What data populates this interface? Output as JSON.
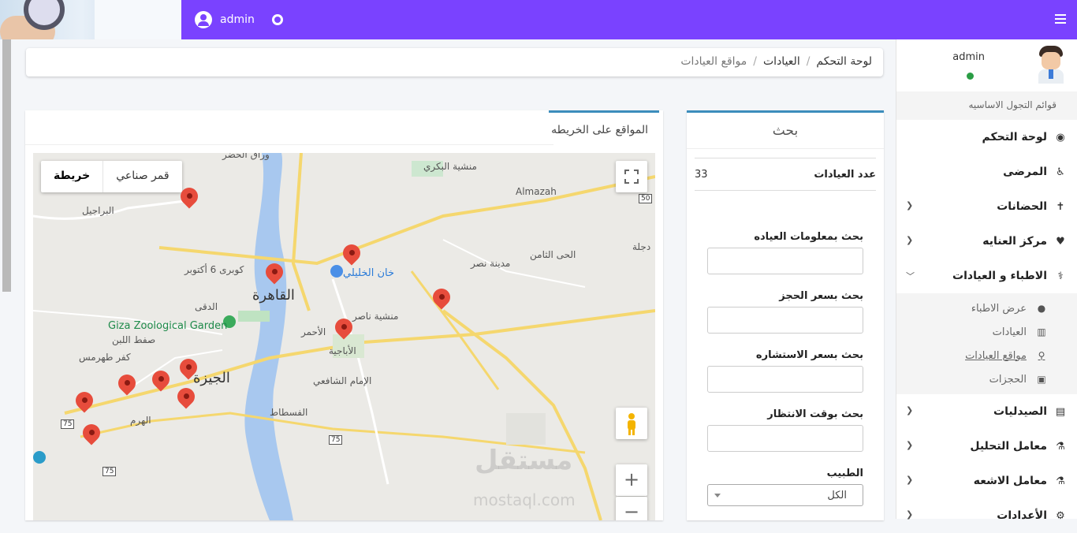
{
  "topbar": {
    "user": "admin"
  },
  "breadcrumb": {
    "items": [
      "لوحة التحكم",
      "العيادات"
    ],
    "current": "مواقع العيادات"
  },
  "search_card": {
    "title": "بحث",
    "count_label": "عدد العيادات",
    "count_value": "33",
    "fields": [
      {
        "label": "بحث بمعلومات العياده"
      },
      {
        "label": "بحث بسعر الحجز"
      },
      {
        "label": "بحث بسعر الاستشاره"
      },
      {
        "label": "بحث بوقت الانتظار"
      }
    ],
    "doctor_label": "الطبيب",
    "doctor_value": "الكل"
  },
  "map_card": {
    "tab": "المواقع على الخريطه",
    "maptype": {
      "map": "خريطة",
      "satellite": "قمر صناعي"
    },
    "labels": {
      "cairo": "القاهرة",
      "giza": "الجيزة",
      "zoo": "Giza Zoological Garden",
      "almazah": "Almazah",
      "khan": "خان الخليلي",
      "warraq": "وراق الحضر",
      "bakry": "منشية البكري",
      "barajil": "البراجيل",
      "tamen": "الحى الثامن",
      "nasr": "مدينة نصر",
      "fustat": "الفسطاط",
      "shafei": "الإمام الشافعي",
      "abageya": "الأباجية",
      "kafr": "كفر طهرمس",
      "saft": "صفط اللبن",
      "dokki": "الدقى",
      "october": "كوبرى 6 أكتوبر",
      "ahmar": "الأحمر",
      "mansheya": "منشية ناصر",
      "dagla": "دجلة",
      "haram": "الهرم"
    },
    "watermark": "مستقل",
    "watermark2": "mostaql.com"
  },
  "sidebar": {
    "user": "admin",
    "header": "قوائم التجول الاساسيه",
    "items": [
      {
        "label": "لوحة التحكم",
        "icon": "dashboard-icon",
        "glyph": "◉"
      },
      {
        "label": "المرضى",
        "icon": "wheelchair-icon",
        "glyph": "♿"
      },
      {
        "label": "الحضانات",
        "icon": "baby-icon",
        "glyph": "✝"
      },
      {
        "label": "مركز العنايه",
        "icon": "heartbeat-icon",
        "glyph": "♥"
      },
      {
        "label": "الاطباء و العيادات",
        "icon": "doctor-icon",
        "glyph": "⚕"
      }
    ],
    "subitems": [
      {
        "label": "عرض الاطباء",
        "icon": "circle-icon",
        "glyph": "●"
      },
      {
        "label": "العيادات",
        "icon": "institution-icon",
        "glyph": "▥"
      },
      {
        "label": "مواقع العيادات",
        "icon": "map-marker-icon",
        "glyph": "⚲"
      },
      {
        "label": "الحجزات",
        "icon": "calendar-icon",
        "glyph": "▣"
      }
    ],
    "items2": [
      {
        "label": "الصيدليات",
        "icon": "medkit-icon",
        "glyph": "▤"
      },
      {
        "label": "معامل التحليل",
        "icon": "flask-icon",
        "glyph": "⚗"
      },
      {
        "label": "معامل الاشعه",
        "icon": "xray-icon",
        "glyph": "⚗"
      },
      {
        "label": "الأعدادات",
        "icon": "cogs-icon",
        "glyph": "⚙"
      }
    ]
  }
}
